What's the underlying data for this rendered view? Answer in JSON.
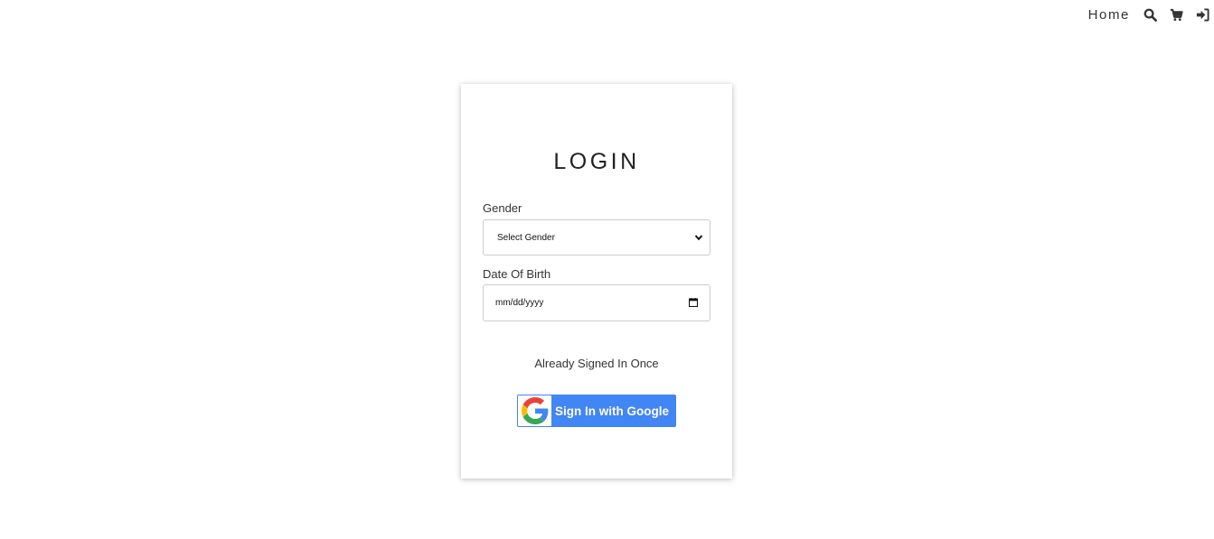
{
  "nav": {
    "home_label": "Home",
    "icons": [
      "search-icon",
      "cart-icon",
      "sign-in-icon"
    ]
  },
  "login": {
    "title": "LOGIN",
    "gender": {
      "label": "Gender",
      "selected": "Select Gender"
    },
    "dob": {
      "label": "Date Of Birth",
      "placeholder": "mm/dd/yyyy"
    },
    "already_text": "Already Signed In Once",
    "google_button_label": "Sign In with Google"
  },
  "colors": {
    "google_blue": "#4285f4",
    "text": "#333333"
  }
}
